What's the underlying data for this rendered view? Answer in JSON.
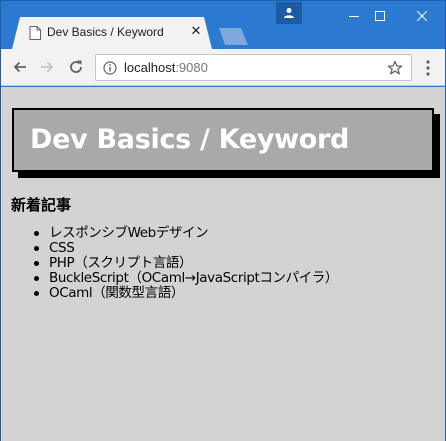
{
  "browser": {
    "tab": {
      "title": "Dev Basics / Keyword",
      "close_glyph": "✕",
      "icon": "page-icon"
    },
    "address": {
      "host": "localhost",
      "port": ":9080"
    }
  },
  "page": {
    "banner_title": "Dev Basics / Keyword",
    "section_heading": "新着記事",
    "articles": [
      "レスポンシブWebデザイン",
      "CSS",
      "PHP（スクリプト言語）",
      "BuckleScript（OCaml→JavaScriptコンパイラ）",
      "OCaml（関数型言語）"
    ]
  },
  "colors": {
    "titlebar": "#2b79d0",
    "page_background": "#d3d3d3",
    "banner_background": "#a9a9a9"
  }
}
